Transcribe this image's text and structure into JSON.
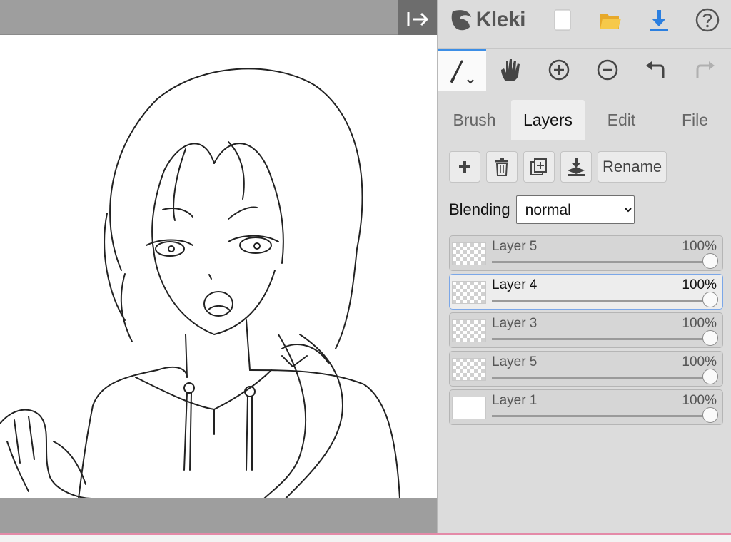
{
  "app": {
    "name": "Kleki"
  },
  "topbar": {
    "new_icon": "new-document-icon",
    "open_icon": "folder-open-icon",
    "save_icon": "download-icon",
    "help_icon": "help-icon"
  },
  "toolbar": {
    "tools": [
      "brush-tool",
      "hand-tool",
      "zoom-in",
      "zoom-out",
      "undo",
      "redo"
    ]
  },
  "tabs": [
    {
      "label": "Brush"
    },
    {
      "label": "Layers"
    },
    {
      "label": "Edit"
    },
    {
      "label": "File"
    }
  ],
  "layer_actions": {
    "add_icon": "plus-icon",
    "delete_icon": "trash-icon",
    "duplicate_icon": "duplicate-icon",
    "merge_icon": "merge-down-icon",
    "rename_label": "Rename"
  },
  "blending": {
    "label": "Blending",
    "value": "normal",
    "options": [
      "normal"
    ]
  },
  "layers": [
    {
      "name": "Layer 5",
      "opacity": "100%",
      "selected": false
    },
    {
      "name": "Layer 4",
      "opacity": "100%",
      "selected": true
    },
    {
      "name": "Layer 3",
      "opacity": "100%",
      "selected": false
    },
    {
      "name": "Layer 5",
      "opacity": "100%",
      "selected": false
    },
    {
      "name": "Layer 1",
      "opacity": "100%",
      "selected": false
    }
  ],
  "colors": {
    "accent": "#3c8ee6",
    "folder": "#f2c23a",
    "download": "#2b7fe0",
    "bottom_line": "#e48aa8"
  }
}
